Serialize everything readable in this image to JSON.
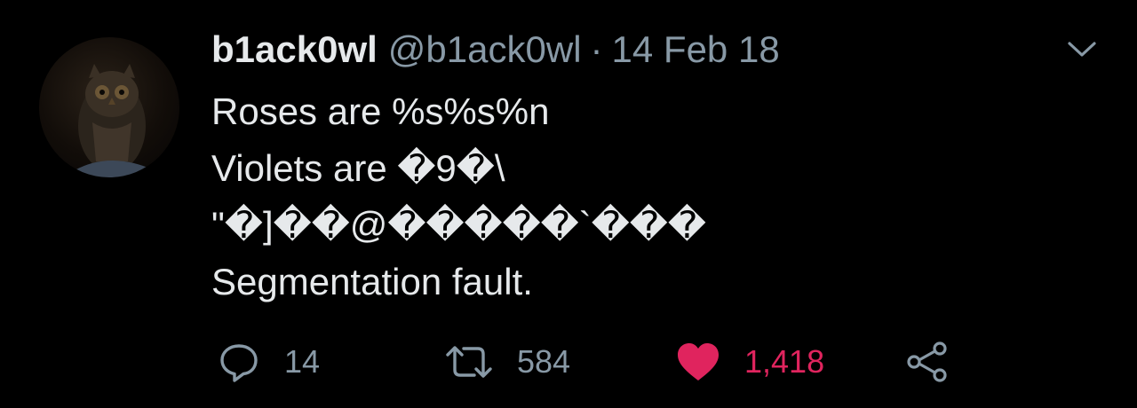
{
  "tweet": {
    "display_name": "b1ack0wl",
    "handle": "@b1ack0wl",
    "separator": "·",
    "date": "14 Feb 18",
    "body_lines": [
      "Roses are %s%s%n",
      "Violets are �9�\\",
      "\"�]��@�����`���",
      "Segmentation fault."
    ]
  },
  "actions": {
    "reply": {
      "icon": "reply-icon",
      "count": "14"
    },
    "retweet": {
      "icon": "retweet-icon",
      "count": "584"
    },
    "like": {
      "icon": "heart-icon",
      "count": "1,418",
      "liked": true
    },
    "share": {
      "icon": "share-icon"
    }
  },
  "menu": {
    "icon": "chevron-down-icon"
  },
  "avatar": {
    "icon": "owl-avatar"
  },
  "colors": {
    "background": "#000000",
    "text_primary": "#e6e9eb",
    "text_secondary": "#8899a6",
    "like_accent": "#e0245e"
  }
}
